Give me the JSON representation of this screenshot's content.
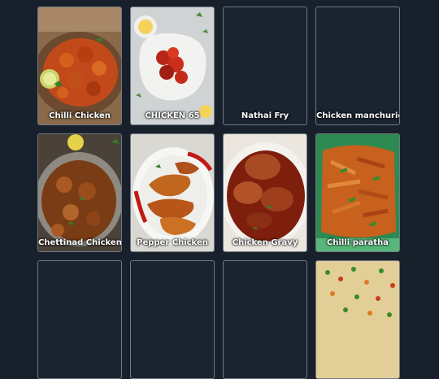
{
  "menu": {
    "items": [
      {
        "label": "Chilli Chicken",
        "image": "chilli-chicken"
      },
      {
        "label": "CHICKEN 65",
        "image": "chicken-65"
      },
      {
        "label": "Nathai Fry",
        "image": null
      },
      {
        "label": "Chicken manchurion",
        "image": null
      },
      {
        "label": "Chettinad Chicken",
        "image": "chettinad-chicken"
      },
      {
        "label": "Pepper Chicken",
        "image": "pepper-chicken"
      },
      {
        "label": "Chicken Gravy",
        "image": "chicken-gravy"
      },
      {
        "label": "Chilli paratha",
        "image": "chilli-paratha"
      },
      {
        "label": "",
        "image": null
      },
      {
        "label": "",
        "image": null
      },
      {
        "label": "",
        "image": null
      },
      {
        "label": "",
        "image": "fried-rice"
      }
    ]
  },
  "colors": {
    "page_bg": "#18212b",
    "card_border": "#6f7984",
    "label_text": "#ffffff"
  }
}
